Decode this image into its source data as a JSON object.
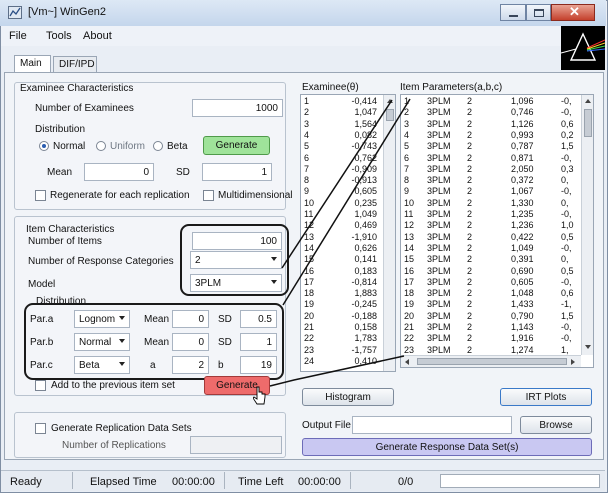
{
  "window": {
    "title": "[Vm~] WinGen2"
  },
  "menu": [
    "File",
    "Tools",
    "About"
  ],
  "tabs": [
    "Main",
    "DIF/IPD"
  ],
  "examinee": {
    "group_title": "Examinee Characteristics",
    "number_label": "Number of Examinees",
    "number_value": "1000",
    "distribution_label": "Distribution",
    "dist_options": [
      "Normal",
      "Uniform",
      "Beta"
    ],
    "generate_label": "Generate",
    "mean_label": "Mean",
    "mean_value": "0",
    "sd_label": "SD",
    "sd_value": "1",
    "regenerate_label": "Regenerate for each replication",
    "multidimensional_label": "Multidimensional"
  },
  "item": {
    "group_title": "Item Characteristics",
    "number_label": "Number of Items",
    "number_value": "100",
    "categories_label": "Number of Response Categories",
    "categories_value": "2",
    "model_label": "Model",
    "model_value": "3PLM",
    "distribution_label": "Distribution",
    "params": [
      {
        "name": "Par.a",
        "dist": "Lognom",
        "p1_label": "Mean",
        "p1": "0",
        "p2_label": "SD",
        "p2": "0.5"
      },
      {
        "name": "Par.b",
        "dist": "Normal",
        "p1_label": "Mean",
        "p1": "0",
        "p2_label": "SD",
        "p2": "1"
      },
      {
        "name": "Par.c",
        "dist": "Beta",
        "p1_label": "a",
        "p1": "2",
        "p2_label": "b",
        "p2": "19"
      }
    ],
    "add_previous_label": "Add to the previous item set",
    "generate_label": "Generate"
  },
  "replication": {
    "group_title": "Generate Replication Data Sets",
    "number_label": "Number of Replications",
    "number_value": ""
  },
  "examinee_list": {
    "header": "Examinee(θ)",
    "rows": [
      [
        "1",
        "-0,414"
      ],
      [
        "2",
        "1,047"
      ],
      [
        "3",
        "1,564"
      ],
      [
        "4",
        "0,082"
      ],
      [
        "5",
        "-0,743"
      ],
      [
        "6",
        "0,762"
      ],
      [
        "7",
        "-0,909"
      ],
      [
        "8",
        "-0,913"
      ],
      [
        "9",
        "0,605"
      ],
      [
        "10",
        "0,235"
      ],
      [
        "11",
        "1,049"
      ],
      [
        "12",
        "0,469"
      ],
      [
        "13",
        "-1,910"
      ],
      [
        "14",
        "0,626"
      ],
      [
        "15",
        "0,141"
      ],
      [
        "16",
        "0,183"
      ],
      [
        "17",
        "-0,814"
      ],
      [
        "18",
        "1,883"
      ],
      [
        "19",
        "-0,245"
      ],
      [
        "20",
        "-0,188"
      ],
      [
        "21",
        "0,158"
      ],
      [
        "22",
        "1,783"
      ],
      [
        "23",
        "-1,757"
      ],
      [
        "24",
        "0,410"
      ]
    ]
  },
  "item_list": {
    "header": "Item Parameters(a,b,c)",
    "rows": [
      [
        "1",
        "3PLM",
        "2",
        "1,096",
        "-0,"
      ],
      [
        "2",
        "3PLM",
        "2",
        "0,746",
        "-0,"
      ],
      [
        "3",
        "3PLM",
        "2",
        "1,126",
        "0,6"
      ],
      [
        "4",
        "3PLM",
        "2",
        "0,993",
        "0,2"
      ],
      [
        "5",
        "3PLM",
        "2",
        "0,787",
        "1,5"
      ],
      [
        "6",
        "3PLM",
        "2",
        "0,871",
        "-0,"
      ],
      [
        "7",
        "3PLM",
        "2",
        "2,050",
        "0,3"
      ],
      [
        "8",
        "3PLM",
        "2",
        "0,372",
        "0,"
      ],
      [
        "9",
        "3PLM",
        "2",
        "1,067",
        "-0,"
      ],
      [
        "10",
        "3PLM",
        "2",
        "1,330",
        "0,"
      ],
      [
        "11",
        "3PLM",
        "2",
        "1,235",
        "-0,"
      ],
      [
        "12",
        "3PLM",
        "2",
        "1,236",
        "1,0"
      ],
      [
        "13",
        "3PLM",
        "2",
        "0,422",
        "0,5"
      ],
      [
        "14",
        "3PLM",
        "2",
        "1,049",
        "-0,"
      ],
      [
        "15",
        "3PLM",
        "2",
        "0,391",
        "0,"
      ],
      [
        "16",
        "3PLM",
        "2",
        "0,690",
        "0,5"
      ],
      [
        "17",
        "3PLM",
        "2",
        "0,605",
        "-0,"
      ],
      [
        "18",
        "3PLM",
        "2",
        "1,048",
        "0,6"
      ],
      [
        "19",
        "3PLM",
        "2",
        "1,433",
        "-1,"
      ],
      [
        "20",
        "3PLM",
        "2",
        "0,790",
        "1,5"
      ],
      [
        "21",
        "3PLM",
        "2",
        "1,143",
        "-0,"
      ],
      [
        "22",
        "3PLM",
        "2",
        "1,916",
        "-0,"
      ],
      [
        "23",
        "3PLM",
        "2",
        "1,274",
        "1,"
      ]
    ]
  },
  "buttons": {
    "histogram": "Histogram",
    "irt_plots": "IRT Plots",
    "browse": "Browse",
    "generate_response": "Generate Response Data Set(s)"
  },
  "output": {
    "label": "Output File",
    "value": ""
  },
  "status": {
    "state": "Ready",
    "elapsed_label": "Elapsed Time",
    "elapsed_value": "00:00:00",
    "left_label": "Time Left",
    "left_value": "00:00:00",
    "progress_text": "0/0"
  },
  "colors": {
    "generate_green": "#9fe39a",
    "generate_red": "#ee6b6b",
    "response_blue": "#c9c8f2"
  }
}
